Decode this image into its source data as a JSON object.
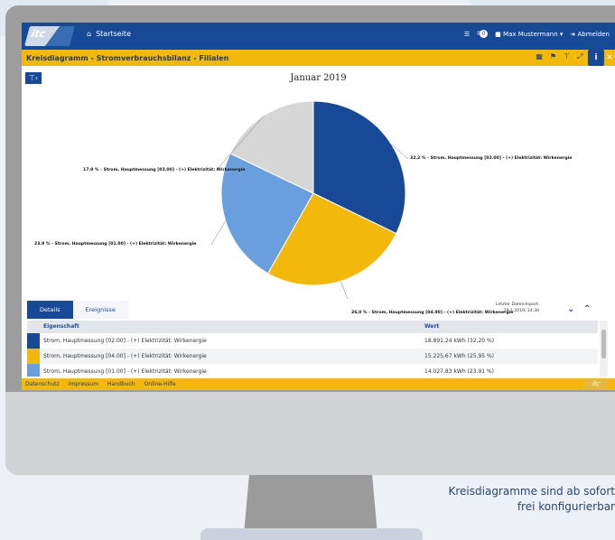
{
  "app": {
    "logo_text": "itc"
  },
  "topbar": {
    "home_label": "Startseite",
    "notification_count": "0",
    "user_name": "Max Mustermann",
    "logout_label": "Abmelden"
  },
  "window": {
    "title": "Kreisdiagramm - Stromverbrauchsbilanz - Filialen"
  },
  "chart_data": {
    "type": "pie",
    "title": "Januar 2019",
    "series": [
      {
        "name": "Strom, Hauptmessung [02.00] - (+) Elektrizität: Wirkenergie",
        "label": "32,2 % - Strom, Hauptmessung [02.00] - (+) Elektrizität: Wirkenergie",
        "value": 32.2,
        "color": "#174996"
      },
      {
        "name": "Strom, Hauptmessung [04.00] - (+) Elektrizität: Wirkenergie",
        "label": "26,0 % - Strom, Hauptmessung [04.00] - (+) Elektrizität: Wirkenergie",
        "value": 26.0,
        "color": "#f2b90c"
      },
      {
        "name": "Strom, Hauptmessung [01.00] - (+) Elektrizität: Wirkenergie",
        "label": "23,9 % - Strom, Hauptmessung [01.00] - (+) Elektrizität: Wirkenergie",
        "value": 23.9,
        "color": "#6a9fdd"
      },
      {
        "name": "Strom, Hauptmessung [03.00] - (+) Elektrizität: Wirkenergie",
        "label": "17,9 % - Strom, Hauptmessung [03.00] - (+) Elektrizität: Wirkenergie",
        "value": 17.9,
        "color": "#d6d6d6"
      }
    ]
  },
  "tabs": [
    {
      "label": "Details"
    },
    {
      "label": "Ereignisse"
    }
  ],
  "last_import": {
    "label": "Letzter Datenimport:",
    "value": "29.1.2019, 14:30"
  },
  "table": {
    "headers": [
      "Eigenschaft",
      "Wert"
    ],
    "rows": [
      {
        "property": "Strom, Hauptmessung [02.00] - (+) Elektrizität: Wirkenergie",
        "value": "18.891,24 kWh (32,20 %)",
        "color": "#174996"
      },
      {
        "property": "Strom, Hauptmessung [04.00] - (+) Elektrizität: Wirkenergie",
        "value": "15.225,67 kWh (25,95 %)",
        "color": "#f2b90c"
      },
      {
        "property": "Strom, Hauptmessung [01.00] - (+) Elektrizität: Wirkenergie",
        "value": "14.027,83 kWh (23,91 %)",
        "color": "#6a9fdd"
      }
    ]
  },
  "footer": {
    "links": [
      "Datenschutz",
      "Impressum",
      "Handbuch",
      "Online-Hilfe"
    ]
  },
  "caption": {
    "line1": "Kreisdiagramme sind ab sofort",
    "line2": "frei konfigurierbar"
  }
}
